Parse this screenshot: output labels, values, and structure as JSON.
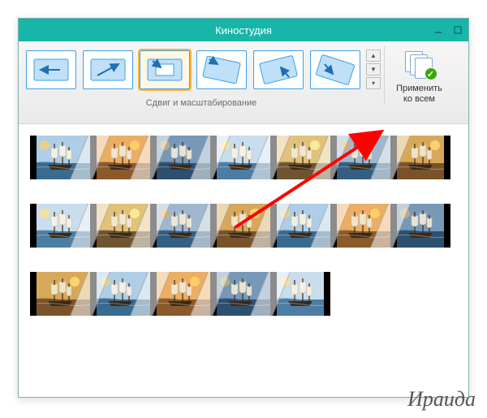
{
  "window": {
    "title": "Киностудия"
  },
  "ribbon": {
    "group_label": "Сдвиг и масштабирование",
    "apply_label_line1": "Применить",
    "apply_label_line2": "ко всем",
    "effects": [
      {
        "name": "pan-left"
      },
      {
        "name": "pan-expand"
      },
      {
        "name": "zoom-in-arrow",
        "selected": true
      },
      {
        "name": "rotate-forward"
      },
      {
        "name": "rotate-up"
      },
      {
        "name": "rotate-down"
      }
    ]
  },
  "tracks": [
    {
      "clips": 7
    },
    {
      "clips": 7
    },
    {
      "clips": 5
    }
  ],
  "signature": "Ираида",
  "ship_palettes": [
    {
      "sky": "#aecde6",
      "sea": "#3a6a8f",
      "sail": "#f4efe2",
      "sun": "#f0d080",
      "mood": "day"
    },
    {
      "sky": "#ebae64",
      "sea": "#8b5a2a",
      "sail": "#efe5cf",
      "sun": "#ffd36a",
      "mood": "sunset"
    },
    {
      "sky": "#7898b8",
      "sea": "#2e4f70",
      "sail": "#e7e3d6",
      "sun": "#c8b070",
      "mood": "storm"
    },
    {
      "sky": "#c9dded",
      "sea": "#4d7da3",
      "sail": "#f6f1e4",
      "sun": "#ffe08a",
      "mood": "day"
    },
    {
      "sky": "#e0c27a",
      "sea": "#6f5530",
      "sail": "#f0e7d2",
      "sun": "#fff0a0",
      "mood": "golden"
    },
    {
      "sky": "#9fb8d0",
      "sea": "#345f82",
      "sail": "#eee7d7",
      "sun": "#d8b060",
      "mood": "day"
    },
    {
      "sky": "#d8a85a",
      "sea": "#7a522a",
      "sail": "#efe3c9",
      "sun": "#ffda75",
      "mood": "sunset"
    }
  ]
}
